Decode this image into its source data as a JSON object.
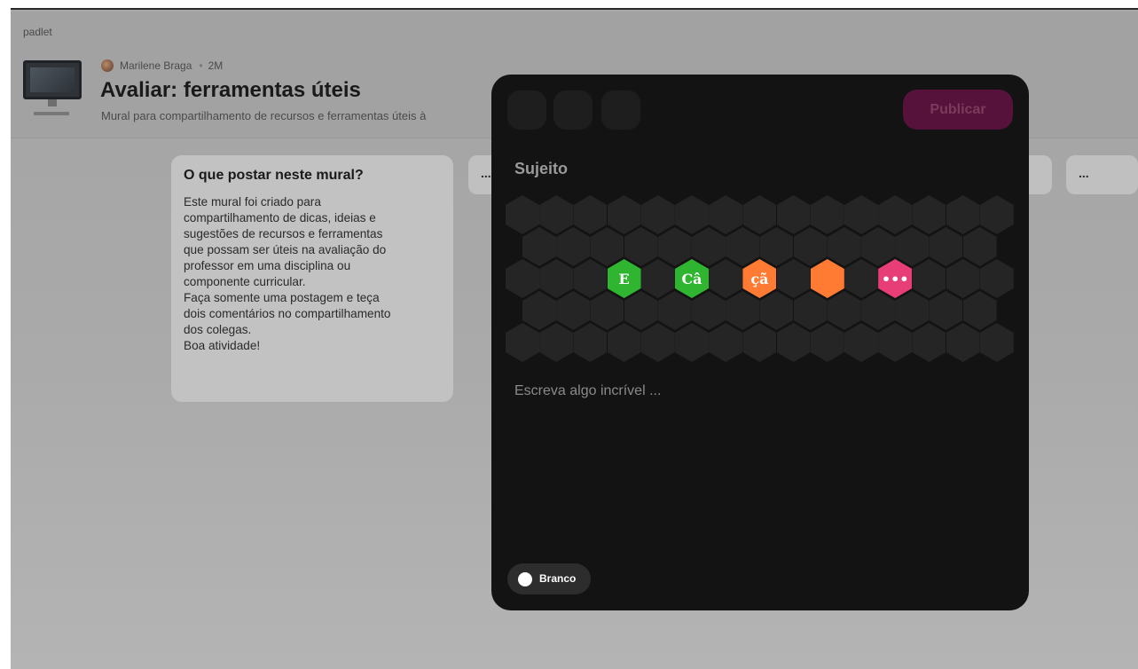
{
  "app": {
    "brand": "padlet"
  },
  "board": {
    "author": "Marilene Braga",
    "separator": "•",
    "age": "2M",
    "title": "Avaliar: ferramentas úteis",
    "subtitle": "Mural para compartilhamento de recursos e ferramentas úteis à"
  },
  "card": {
    "title": "O que postar neste mural?",
    "body": "Este mural foi criado para\ncompartilhamento de dicas, ideias e\nsugestões de recursos e ferramentas\nque possam ser úteis na avaliação do\nprofessor em uma disciplina ou\ncomponente curricular.\nFaça somente uma postagem e teça\ndois comentários no compartilhamento\ndos colegas.\nBoa atividade!"
  },
  "stubs": {
    "left_label": "...",
    "right_label": "..."
  },
  "composer": {
    "publish_label": "Publicar",
    "subject_placeholder": "Sujeito",
    "body_placeholder": "Escreva algo incrível ...",
    "attachments": [
      {
        "label": "E",
        "color": "#2fb52f"
      },
      {
        "label": "Câ",
        "color": "#2fb52f"
      },
      {
        "label": "çã",
        "color": "#ff7a33"
      },
      {
        "label": "",
        "color": "#ff7a33"
      },
      {
        "label": "•••",
        "color": "#e83e78"
      }
    ],
    "color_toggle_label": "Branco"
  },
  "colors": {
    "accent_publish": "#56123a",
    "modal_bg": "#131313"
  }
}
